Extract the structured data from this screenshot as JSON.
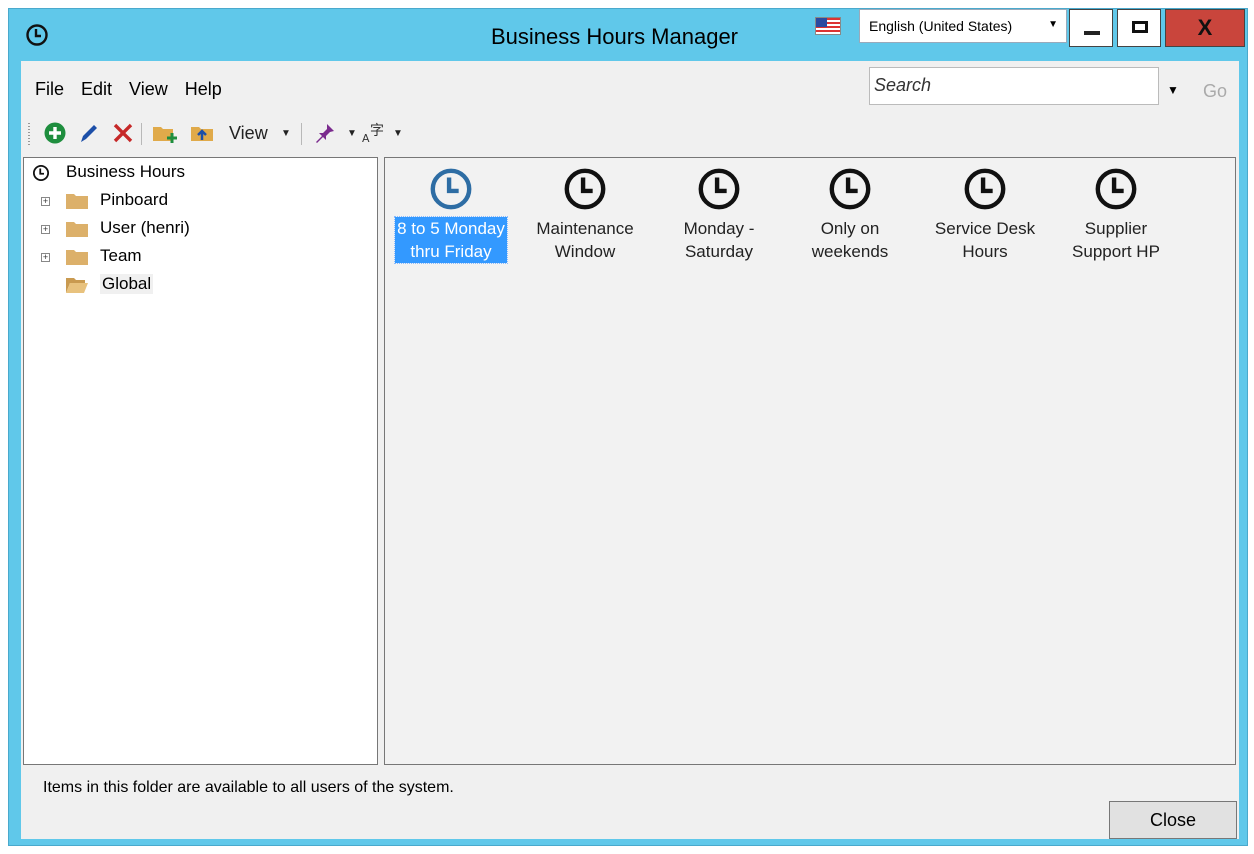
{
  "window": {
    "title": "Business Hours Manager"
  },
  "language": {
    "selected": "English (United States)"
  },
  "window_controls": {
    "close": "X"
  },
  "menu": {
    "items": [
      "File",
      "Edit",
      "View",
      "Help"
    ]
  },
  "search": {
    "placeholder": "Search",
    "go": "Go"
  },
  "toolbar": {
    "view_label": "View"
  },
  "tree": {
    "root": "Business Hours",
    "nodes": [
      {
        "label": "Pinboard"
      },
      {
        "label": "User (henri)"
      },
      {
        "label": "Team"
      },
      {
        "label": "Global"
      }
    ]
  },
  "items": [
    {
      "line1": "8 to 5 Monday",
      "line2": "thru Friday",
      "selected": true
    },
    {
      "line1": "Maintenance",
      "line2": "Window"
    },
    {
      "line1": "Monday -",
      "line2": "Saturday"
    },
    {
      "line1": "Only on",
      "line2": "weekends"
    },
    {
      "line1": "Service Desk",
      "line2": "Hours"
    },
    {
      "line1": "Supplier",
      "line2": "Support HP"
    }
  ],
  "status": {
    "text": "Items in this folder are available to all users of the system."
  },
  "buttons": {
    "close": "Close"
  },
  "colors": {
    "accent": "#60c8ea",
    "selection": "#3399ff",
    "close_red": "#c9453c",
    "selected_clock": "#2e6da4"
  }
}
